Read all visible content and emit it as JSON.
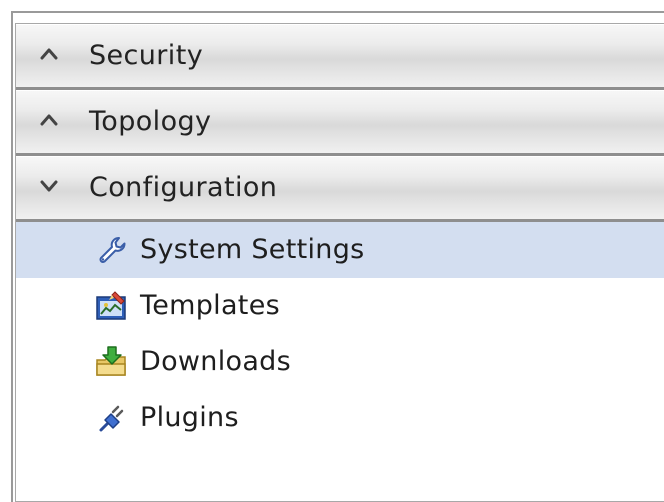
{
  "sections": [
    {
      "label": "Security",
      "state": "collapsed",
      "icon": "chevron-up-icon"
    },
    {
      "label": "Topology",
      "state": "collapsed",
      "icon": "chevron-up-icon"
    },
    {
      "label": "Configuration",
      "state": "expanded",
      "icon": "chevron-down-icon"
    }
  ],
  "configuration_items": [
    {
      "label": "System Settings",
      "icon": "wrench-icon",
      "selected": true
    },
    {
      "label": "Templates",
      "icon": "template-icon",
      "selected": false
    },
    {
      "label": "Downloads",
      "icon": "download-folder-icon",
      "selected": false
    },
    {
      "label": "Plugins",
      "icon": "plug-icon",
      "selected": false
    }
  ],
  "colors": {
    "selection": "#d3def0",
    "header_border": "#8e8e8e",
    "text": "#222222"
  }
}
